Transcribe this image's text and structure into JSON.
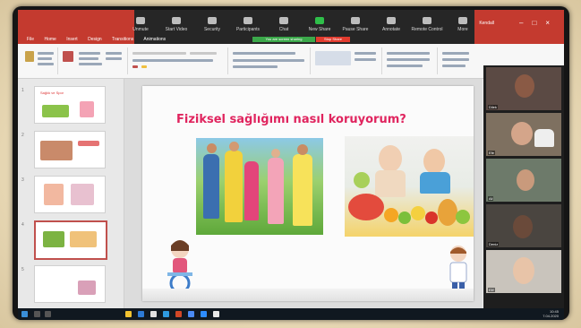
{
  "zoom_toolbar": {
    "buttons": [
      "Unmute",
      "Start Video",
      "Security",
      "Participants",
      "Chat",
      "New Share",
      "Pause Share",
      "Annotate",
      "Remote Control",
      "More"
    ],
    "stop_share_label": "Stop Share",
    "sharing_label": "You are screen sharing",
    "user_name": "Kendall"
  },
  "ppt": {
    "tabs": [
      "File",
      "Home",
      "Insert",
      "Design",
      "Transitions",
      "Animations"
    ]
  },
  "slide": {
    "title": "Fiziksel sağlığımı nasıl koruyorum?"
  },
  "thumbnails": [
    {
      "num": "1",
      "title": "Sağlık ve Spor"
    },
    {
      "num": "2",
      "title": ""
    },
    {
      "num": "3",
      "title": ""
    },
    {
      "num": "4",
      "title": ""
    },
    {
      "num": "5",
      "title": ""
    }
  ],
  "participants": [
    {
      "name": "Dilek"
    },
    {
      "name": "Efe"
    },
    {
      "name": "Ali"
    },
    {
      "name": "Deniz"
    },
    {
      "name": "Elif"
    }
  ],
  "taskbar": {
    "time": "10:45",
    "date": "7.04.2020"
  },
  "colors": {
    "title": "#e0245e",
    "zoom_red": "#c43a2f",
    "share_green": "#3ba84a"
  }
}
